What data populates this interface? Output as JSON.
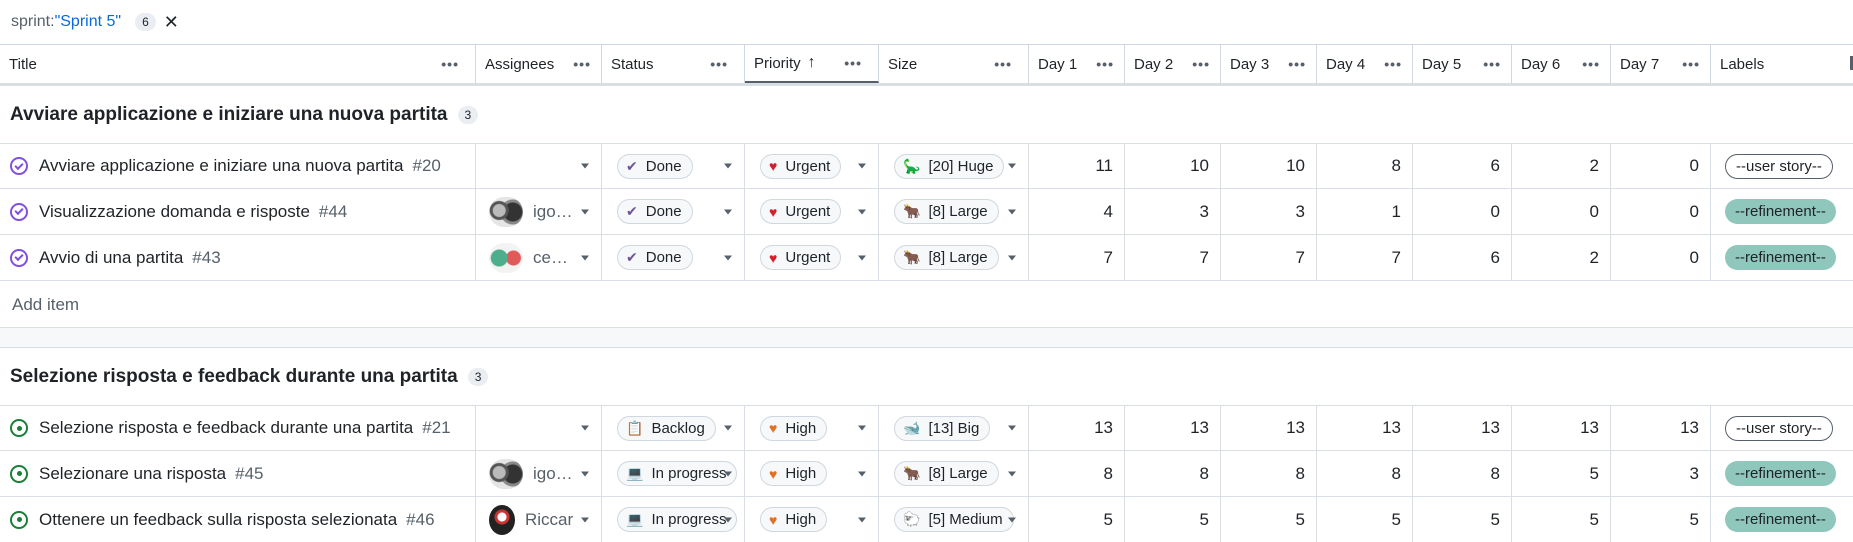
{
  "filter": {
    "key": "sprint:",
    "value": "\"Sprint 5\"",
    "count": "6",
    "clear_icon": "close-icon"
  },
  "columns": [
    {
      "label": "Title"
    },
    {
      "label": "Assignees"
    },
    {
      "label": "Status"
    },
    {
      "label": "Priority",
      "sort": "ascending"
    },
    {
      "label": "Size"
    },
    {
      "label": "Day 1"
    },
    {
      "label": "Day 2"
    },
    {
      "label": "Day 3"
    },
    {
      "label": "Day 4"
    },
    {
      "label": "Day 5"
    },
    {
      "label": "Day 6"
    },
    {
      "label": "Day 7"
    },
    {
      "label": "Labels"
    }
  ],
  "groups": [
    {
      "title": "Avviare applicazione e iniziare una nuova partita",
      "count": "3",
      "rows": [
        {
          "state": "done",
          "title": "Avviare applicazione e iniziare una nuova partita",
          "number": "#20",
          "assignee": "",
          "status": "Done",
          "priority": "Urgent",
          "size": "[20] Huge",
          "days": [
            "11",
            "10",
            "10",
            "8",
            "6",
            "2",
            "0"
          ],
          "label": "--user story--"
        },
        {
          "state": "done",
          "title": "Visualizzazione domanda e risposte",
          "number": "#44",
          "assignee": "igo…",
          "status": "Done",
          "priority": "Urgent",
          "size": "[8] Large",
          "days": [
            "4",
            "3",
            "3",
            "1",
            "0",
            "0",
            "0"
          ],
          "label": "--refinement--"
        },
        {
          "state": "done",
          "title": "Avvio di una partita",
          "number": "#43",
          "assignee": "ce…",
          "status": "Done",
          "priority": "Urgent",
          "size": "[8] Large",
          "days": [
            "7",
            "7",
            "7",
            "7",
            "6",
            "2",
            "0"
          ],
          "label": "--refinement--"
        }
      ]
    },
    {
      "title": "Selezione risposta e feedback durante una partita",
      "count": "3",
      "rows": [
        {
          "state": "open",
          "title": "Selezione risposta e feedback durante una partita",
          "number": "#21",
          "assignee": "",
          "status": "Backlog",
          "priority": "High",
          "size": "[13] Big",
          "days": [
            "13",
            "13",
            "13",
            "13",
            "13",
            "13",
            "13"
          ],
          "label": "--user story--"
        },
        {
          "state": "open",
          "title": "Selezionare una risposta",
          "number": "#45",
          "assignee": "igo…",
          "status": "In progress",
          "priority": "High",
          "size": "[8] Large",
          "days": [
            "8",
            "8",
            "8",
            "8",
            "8",
            "5",
            "3"
          ],
          "label": "--refinement--"
        },
        {
          "state": "open",
          "title": "Ottenere un feedback sulla risposta selezionata",
          "number": "#46",
          "assignee": "Riccar",
          "status": "In progress",
          "priority": "High",
          "size": "[5] Medium",
          "days": [
            "5",
            "5",
            "5",
            "5",
            "5",
            "5",
            "5"
          ],
          "label": "--refinement--"
        }
      ]
    }
  ],
  "add_item": "Add item",
  "colors": {
    "done": "#8250df",
    "open": "#1a7f37",
    "refinement": "#8fc7bd",
    "urgent": "#cf222e",
    "high": "#e16f24"
  }
}
